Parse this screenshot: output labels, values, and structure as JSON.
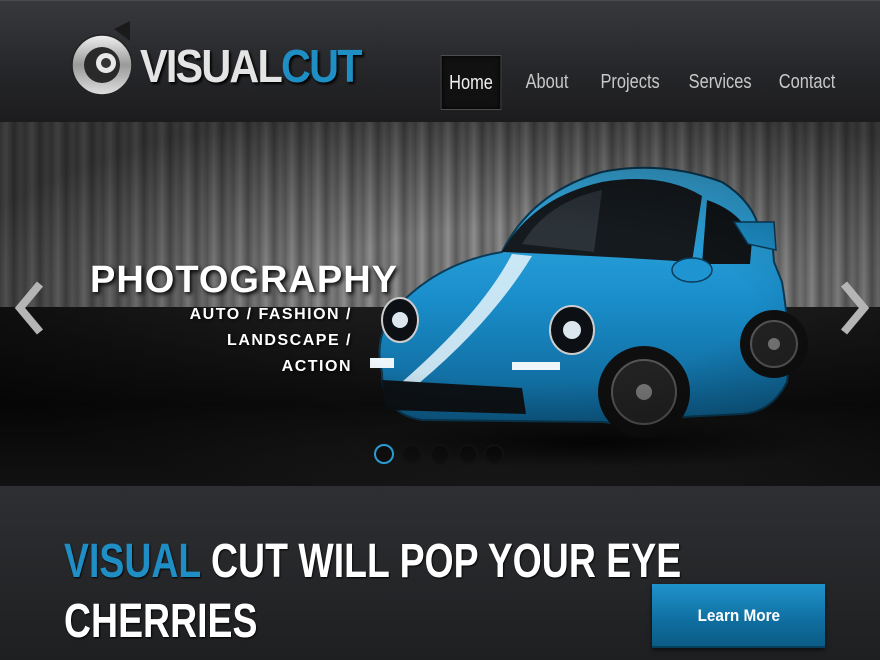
{
  "brand": {
    "logo_part1": "VISUAL",
    "logo_part2": "CUT",
    "accent_color": "#1f8ec4"
  },
  "nav": {
    "items": [
      {
        "label": "Home",
        "active": true
      },
      {
        "label": "About",
        "active": false
      },
      {
        "label": "Projects",
        "active": false
      },
      {
        "label": "Services",
        "active": false
      },
      {
        "label": "Contact",
        "active": false
      }
    ]
  },
  "slider": {
    "title": "PHOTOGRAPHY",
    "subtitle_line1": "AUTO / FASHION / LANDSCAPE /",
    "subtitle_line2": "ACTION",
    "prev_icon": "chevron-left-icon",
    "next_icon": "chevron-right-icon",
    "slide_count": 5,
    "active_slide": 1
  },
  "promo": {
    "headline_accent": "VISUAL",
    "headline_rest_line1": " CUT WILL POP YOUR EYE",
    "headline_line2": "CHERRIES",
    "button_label": "Learn More",
    "button_color": "#1a86bd"
  }
}
